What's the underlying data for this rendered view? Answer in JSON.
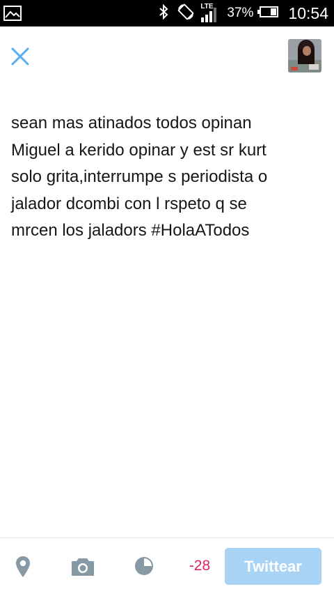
{
  "status_bar": {
    "network_label": "LTE",
    "battery_percent": "37%",
    "time": "10:54"
  },
  "composer": {
    "tweet_text": "sean mas atinados todos opinan\nMiguel a kerido opinar y est sr kurt\nsolo grita,interrumpe s periodista o\njalador dcombi con l rspeto q se\nmrcen los jaladors #HolaATodos"
  },
  "toolbar": {
    "char_counter": "-28",
    "tweet_button_label": "Twittear"
  },
  "colors": {
    "accent": "#55acee",
    "button_disabled": "#a8d3f5",
    "icon_gray": "#8899a6",
    "counter_negative": "#e0245e"
  }
}
